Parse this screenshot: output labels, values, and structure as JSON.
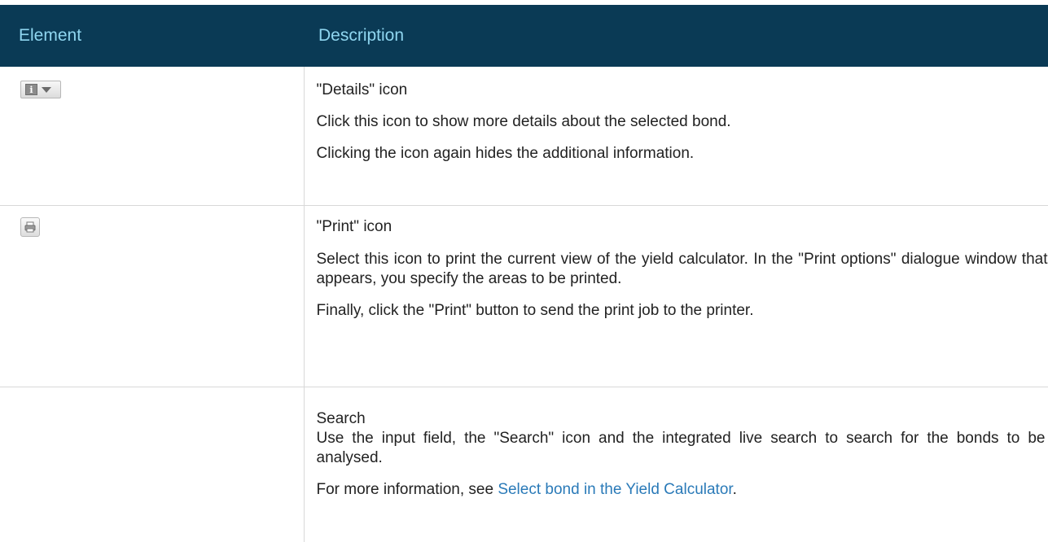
{
  "table": {
    "headers": {
      "element": "Element",
      "description": "Description"
    },
    "rows": [
      {
        "icon": "details-icon",
        "title": "\"Details\" icon",
        "paragraphs": [
          "Click this icon to show more details about the selected bond.",
          "Clicking the icon again hides the additional information."
        ]
      },
      {
        "icon": "print-icon",
        "title": "\"Print\" icon",
        "paragraphs": [
          "Select this icon to print the current view of the yield calculator. In the \"Print options\" dialogue window that appears, you specify the areas to be printed.",
          "Finally, click the \"Print\" button to send the print job to the printer."
        ]
      },
      {
        "icon": "",
        "title": "Search",
        "paragraphs": [
          "Use the input field, the \"Search\" icon and the integrated live search to search for the bonds to be analysed."
        ],
        "more_info": {
          "prefix": "For more information, see ",
          "link_text": "Select bond in the Yield Calculator",
          "suffix": "."
        }
      }
    ]
  },
  "colors": {
    "header_bg": "#0a3a55",
    "header_text": "#8fd6f0",
    "link": "#2a7ab8"
  }
}
